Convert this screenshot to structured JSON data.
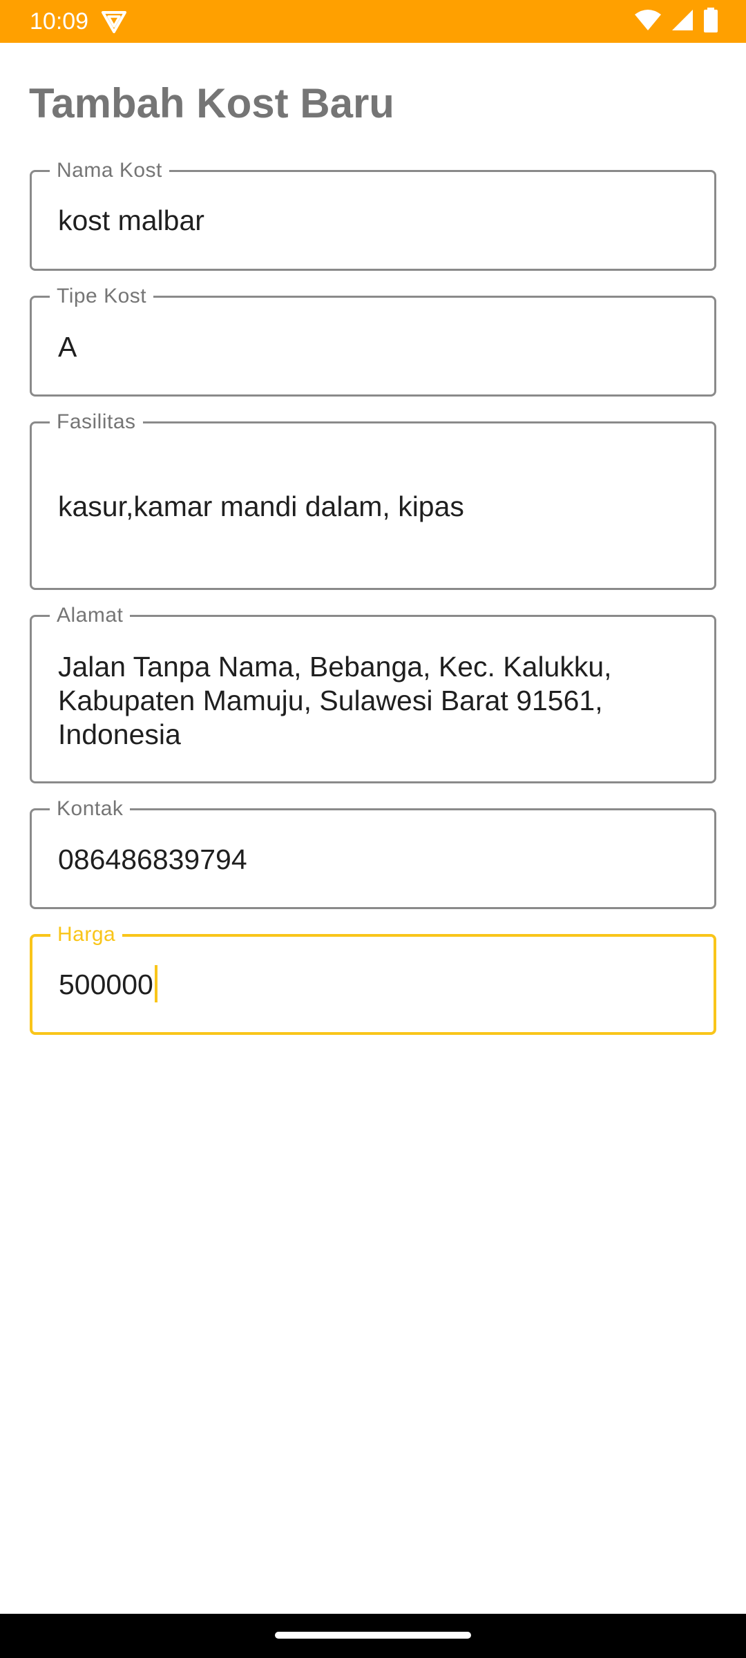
{
  "status_bar": {
    "time": "10:09",
    "background_color": "#ffa000",
    "icons": [
      "app-notification-icon",
      "wifi-icon",
      "signal-icon",
      "battery-icon"
    ]
  },
  "page": {
    "title": "Tambah Kost Baru"
  },
  "form": {
    "nama_kost": {
      "label": "Nama Kost",
      "value": "kost malbar"
    },
    "tipe_kost": {
      "label": "Tipe Kost",
      "value": "A"
    },
    "fasilitas": {
      "label": "Fasilitas",
      "value": "kasur,kamar mandi dalam, kipas"
    },
    "alamat": {
      "label": "Alamat",
      "value": "Jalan Tanpa Nama, Bebanga, Kec. Kalukku, Kabupaten Mamuju, Sulawesi Barat 91561, Indonesia"
    },
    "kontak": {
      "label": "Kontak",
      "value": "086486839794"
    },
    "harga": {
      "label": "Harga",
      "value": "500000",
      "focused": true
    }
  },
  "colors": {
    "accent": "#ffa000",
    "focus": "#f9c51a",
    "label": "#757575",
    "border": "#8a8a8a"
  }
}
